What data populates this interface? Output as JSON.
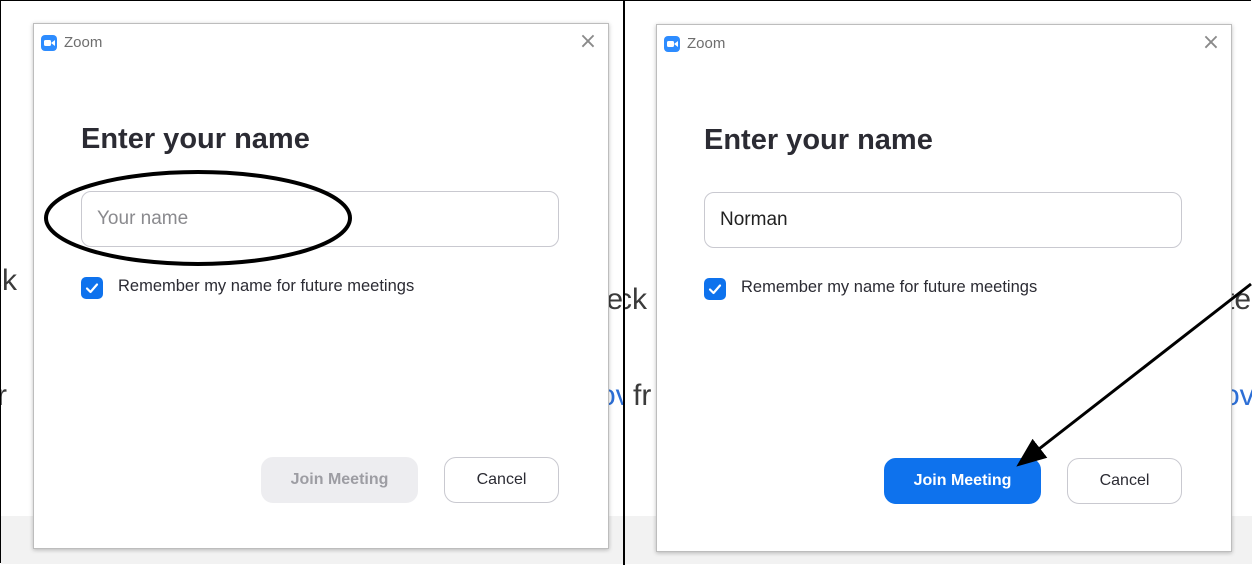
{
  "left": {
    "window_title": "Zoom",
    "close_glyph": "×",
    "heading": "Enter your name",
    "name_value": "",
    "name_placeholder": "Your name",
    "remember_checked": true,
    "remember_label": "Remember my name for future meetings",
    "join_label": "Join Meeting",
    "join_state": "disabled",
    "cancel_label": "Cancel",
    "bg_fragments": [
      "ck",
      "te",
      "r",
      "ov"
    ],
    "annotation": "ellipse-highlight around name input"
  },
  "right": {
    "window_title": "Zoom",
    "close_glyph": "×",
    "heading": "Enter your name",
    "name_value": "Norman",
    "name_placeholder": "Your name",
    "remember_checked": true,
    "remember_label": "Remember my name for future meetings",
    "join_label": "Join Meeting",
    "join_state": "enabled",
    "cancel_label": "Cancel",
    "bg_fragments": [
      "ck",
      "te",
      "fr",
      "ov"
    ],
    "annotation": "arrow pointing to Join Meeting button"
  },
  "icons": {
    "app_logo": "zoom-logo-icon",
    "close": "close-icon",
    "checkbox": "checkmark-icon"
  },
  "colors": {
    "zoom_blue": "#2d8cff",
    "primary_button": "#0e72ed",
    "disabled_button": "#ededf0",
    "link_blue": "#2d6fd6"
  }
}
